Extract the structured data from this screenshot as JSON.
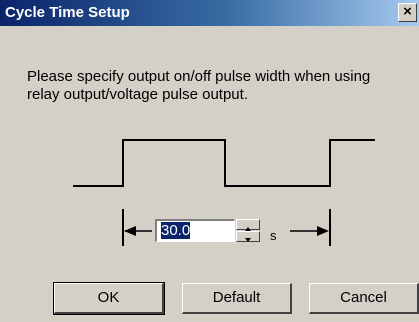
{
  "window": {
    "title": "Cycle Time Setup",
    "close_glyph": "×"
  },
  "message": "Please specify output on/off pulse width when using relay output/voltage pulse output.",
  "cycle": {
    "value": "30.0",
    "unit": "s"
  },
  "buttons": {
    "ok": "OK",
    "default": "Default",
    "cancel": "Cancel"
  }
}
